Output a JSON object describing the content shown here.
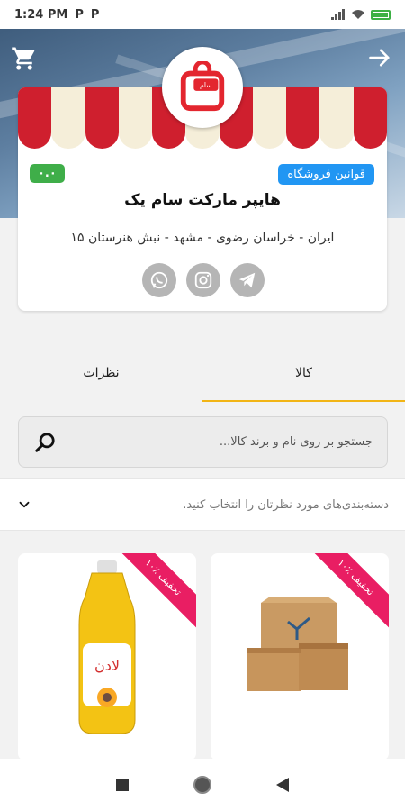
{
  "status_bar": {
    "time": "1:24 PM",
    "left_icons": [
      "parking-icon",
      "parking-icon"
    ],
    "battery_color": "#3cb043"
  },
  "header": {
    "cart_icon": "cart-icon",
    "back_icon": "arrow-right-icon"
  },
  "store": {
    "name": "هایپر مارکت سام یک",
    "address": "ایران - خراسان رضوی - مشهد - نبش هنرستان ۱۵",
    "rating": "۰.۰",
    "rules_label": "قوانین فروشگاه",
    "logo_text": "سام",
    "socials": [
      "whatsapp-icon",
      "instagram-icon",
      "telegram-icon"
    ]
  },
  "tabs": [
    {
      "label": "نظرات",
      "active": false
    },
    {
      "label": "کالا",
      "active": true
    }
  ],
  "search": {
    "placeholder": "جستجو بر روی نام و برند کالا..."
  },
  "categories": {
    "prompt": "دسته‌بندی‌های مورد نظرتان را انتخاب کنید."
  },
  "products": [
    {
      "discount": "۱۰٪ تخفیف",
      "image": "oil-bottle"
    },
    {
      "discount": "۱۰٪ تخفیف",
      "image": "boxes"
    }
  ],
  "nav": {
    "icons": [
      "square-icon",
      "circle-icon",
      "triangle-back-icon"
    ]
  },
  "colors": {
    "accent": "#f2b516",
    "rating": "#3fae49",
    "rules": "#2196f3",
    "ribbon": "#e91e63",
    "awning_red": "#cf1f2e"
  }
}
